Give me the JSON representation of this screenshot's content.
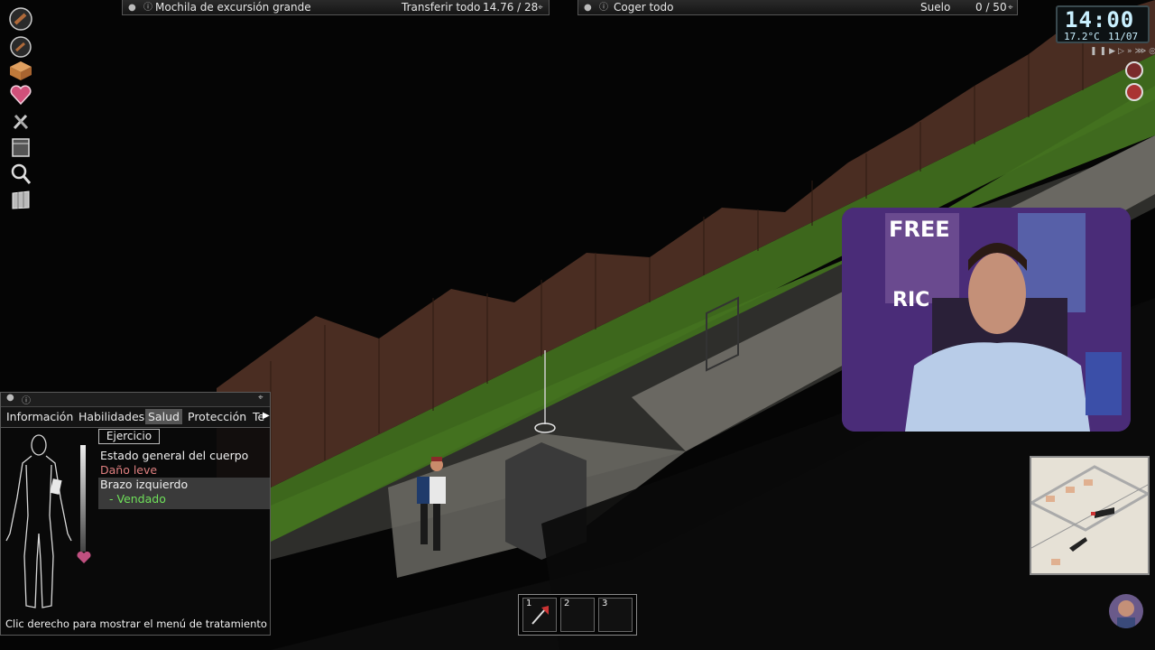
{
  "top_panels": {
    "left": {
      "title": "Mochila de excursión grande",
      "transfer_label": "Transferir todo",
      "weight": "14.76 / 28"
    },
    "right": {
      "title": "Coger todo",
      "floor_label": "Suelo",
      "weight": "0 / 50"
    }
  },
  "clock": {
    "time": "14:00",
    "temperature": "17.2°C",
    "date": "11/07"
  },
  "sidebar": {
    "items": [
      {
        "icon": "main-hand-weapon-icon"
      },
      {
        "icon": "secondary-weapon-icon"
      },
      {
        "icon": "inventory-box-icon"
      },
      {
        "icon": "health-heart-icon"
      },
      {
        "icon": "crafting-hammer-icon"
      },
      {
        "icon": "storage-container-icon"
      },
      {
        "icon": "search-magnifier-icon"
      },
      {
        "icon": "map-icon"
      }
    ]
  },
  "health_panel": {
    "tabs": [
      "Información",
      "Habilidades",
      "Salud",
      "Protección",
      "Te"
    ],
    "active_tab": "Salud",
    "section_button": "Ejercicio",
    "status_header": "Estado general del cuerpo",
    "status_value": "Daño leve",
    "body_part": "Brazo izquierdo",
    "treatment": "- Vendado",
    "footer_hint": "Clic derecho para mostrar el menú de tratamiento",
    "colors": {
      "damage": "#e08080",
      "treatment": "#6fe05a"
    }
  },
  "hotbar": {
    "slots": [
      {
        "number": "1"
      },
      {
        "number": "2"
      },
      {
        "number": "3"
      }
    ]
  },
  "webcam": {
    "poster_text_1": "FREE",
    "poster_text_2": "RIC"
  }
}
